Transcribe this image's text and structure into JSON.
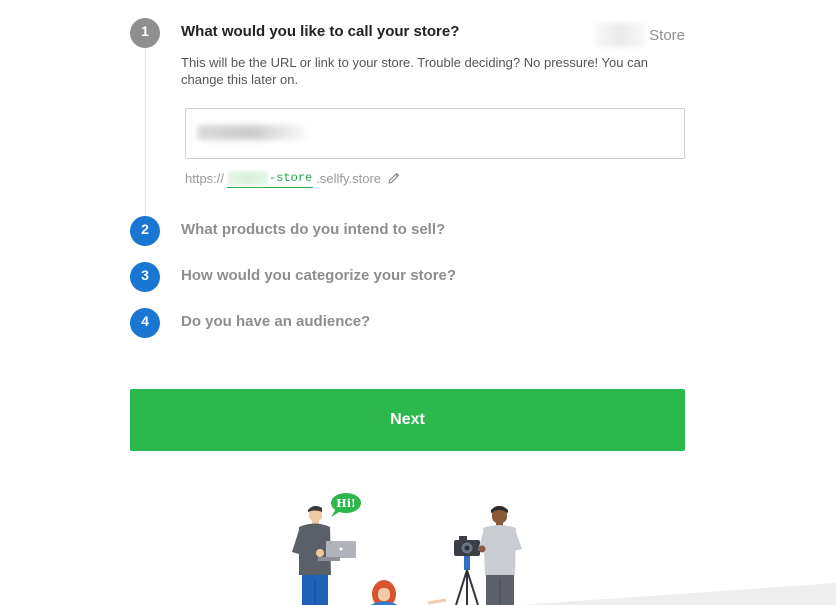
{
  "wizard": {
    "steps": [
      {
        "number": "1",
        "title": "What would you like to call your store?",
        "state": "active"
      },
      {
        "number": "2",
        "title": "What products do you intend to sell?",
        "state": "pending"
      },
      {
        "number": "3",
        "title": "How would you categorize your store?",
        "state": "pending"
      },
      {
        "number": "4",
        "title": "Do you have an audience?",
        "state": "pending"
      }
    ],
    "store_preview_suffix": "Store",
    "description": "This will be the URL or link to your store. Trouble deciding? No pressure! You can change this later on.",
    "store_name_input": {
      "value": "",
      "placeholder": ""
    },
    "url": {
      "prefix": "https://",
      "slug_suffix": "-store",
      "domain": ".sellfy.store"
    },
    "next_label": "Next"
  },
  "illustration": {
    "speech_bubble": "Hi!"
  },
  "colors": {
    "accent_green": "#2cb84d",
    "step_blue": "#1976d2",
    "step_active_gray": "#8f8f8f",
    "slug_green": "#23a24c"
  },
  "icons": [
    "pencil-icon"
  ]
}
